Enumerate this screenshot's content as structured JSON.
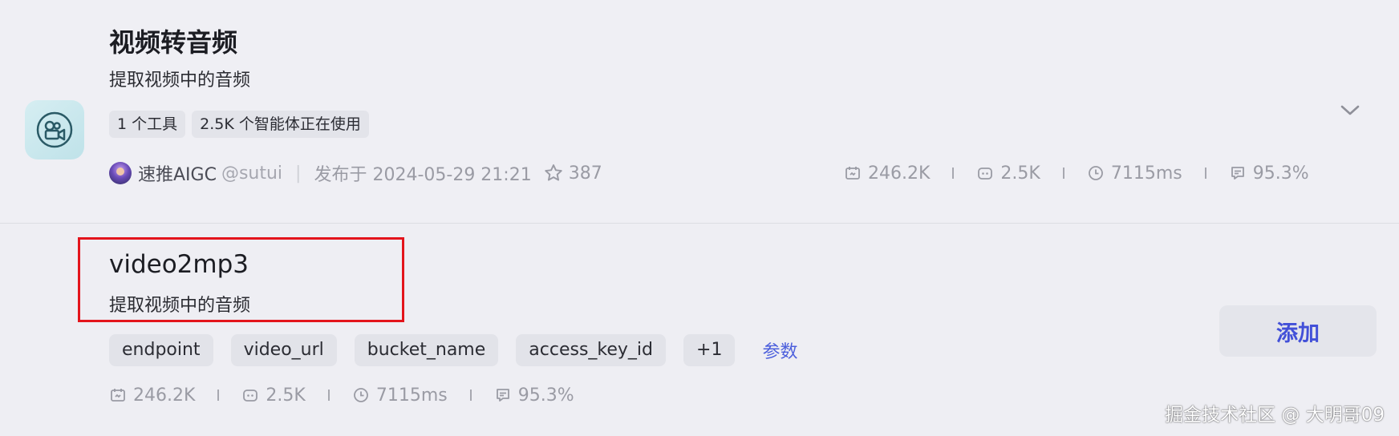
{
  "plugin": {
    "title": "视频转音频",
    "description": "提取视频中的音频",
    "tags": [
      "1 个工具",
      "2.5K 个智能体正在使用"
    ],
    "author": "速推AIGC",
    "handle": "@sutui",
    "published": "发布于 2024-05-29 21:21",
    "stars": "387",
    "stats": {
      "calls": "246.2K",
      "bots": "2.5K",
      "latency": "7115ms",
      "success": "95.3%"
    }
  },
  "tool": {
    "name": "video2mp3",
    "description": "提取视频中的音频",
    "params": [
      "endpoint",
      "video_url",
      "bucket_name",
      "access_key_id",
      "+1"
    ],
    "params_link": "参数",
    "stats": {
      "calls": "246.2K",
      "bots": "2.5K",
      "latency": "7115ms",
      "success": "95.3%"
    },
    "add_label": "添加"
  },
  "watermark": "掘金技术社区 @ 大明哥09",
  "colors": {
    "accent": "#4250d8",
    "highlight": "#e3141b",
    "muted": "#9a9ba4"
  },
  "icons": {
    "plugin": "video-camera-icon",
    "calls": "sync-icon",
    "bots": "bot-icon",
    "latency": "clock-icon",
    "success": "chart-list-icon",
    "expand": "chevron-down-icon",
    "star": "star-icon"
  }
}
